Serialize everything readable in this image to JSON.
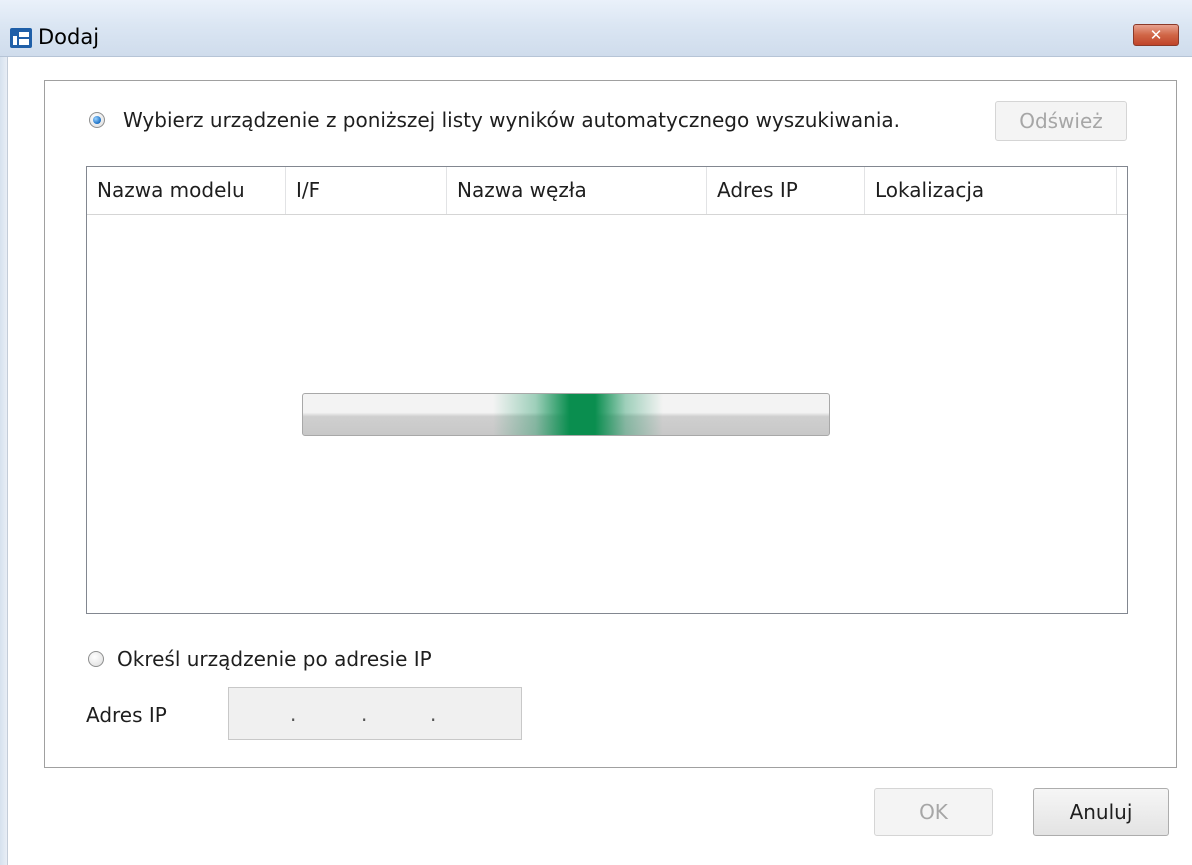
{
  "window": {
    "title": "Dodaj",
    "close_label": "✕"
  },
  "auto_search": {
    "label": "Wybierz urządzenie z poniższej listy wyników automatycznego wyszukiwania.",
    "selected": true,
    "refresh_label": "Odśwież",
    "refresh_enabled": false
  },
  "device_list": {
    "columns": [
      "Nazwa modelu",
      "I/F",
      "Nazwa węzła",
      "Adres IP",
      "Lokalizacja"
    ],
    "rows": [],
    "loading": true
  },
  "manual_ip": {
    "label": "Określ urządzenie po adresie IP",
    "selected": false,
    "field_label": "Adres IP",
    "ip_separators": [
      ".",
      ".",
      "."
    ],
    "enabled": false
  },
  "footer": {
    "ok_label": "OK",
    "ok_enabled": false,
    "cancel_label": "Anuluj"
  },
  "colors": {
    "progress_accent": "#0a8e4f",
    "close_button": "#c0442a",
    "radio_checked": "#1a6fc4"
  }
}
